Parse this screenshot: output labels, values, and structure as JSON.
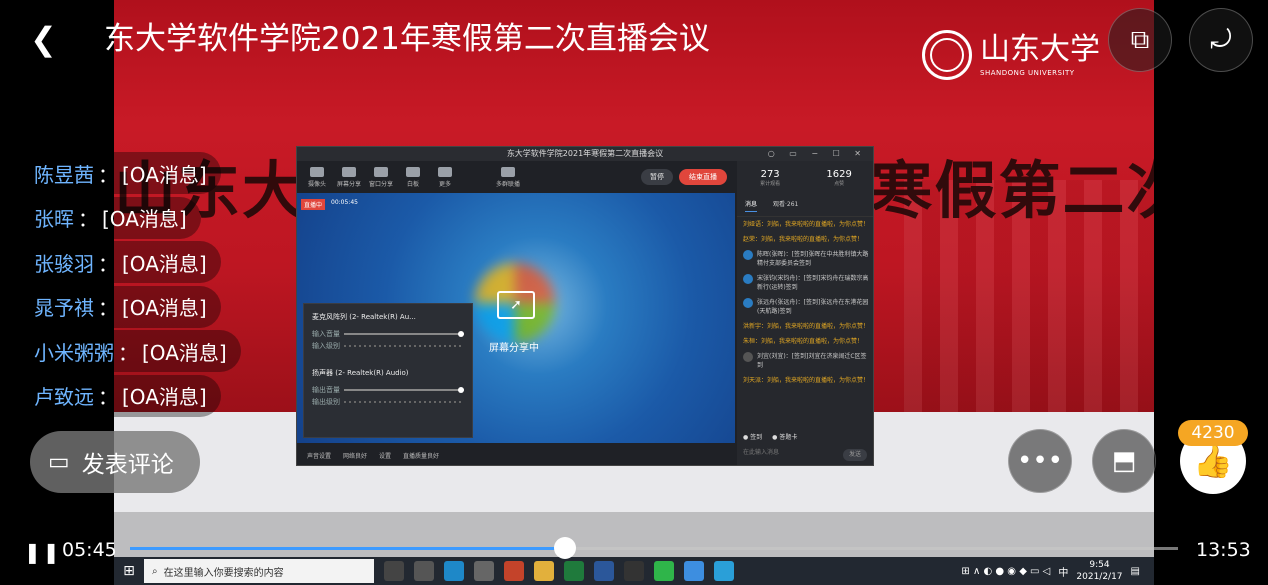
{
  "header": {
    "back_icon": "back-arrow-icon",
    "title": "东大学软件学院2021年寒假第二次直播会议",
    "pip_icon": "picture-in-picture-icon",
    "rotate_icon": "rotate-screen-icon"
  },
  "banner": {
    "title": "山东大学软件学院2021年寒假第二次直",
    "logo_cn": "山东大学",
    "logo_en": "SHANDONG UNIVERSITY"
  },
  "comments": [
    {
      "name": "陈昱茜",
      "sep": "：",
      "text": "[OA消息]"
    },
    {
      "name": "张晖",
      "sep": "：",
      "text": "[OA消息]"
    },
    {
      "name": "张骏羽",
      "sep": "：",
      "text": "[OA消息]"
    },
    {
      "name": "晁予祺",
      "sep": "：",
      "text": "[OA消息]"
    },
    {
      "name": "小米粥粥",
      "sep": "：",
      "text": "[OA消息]"
    },
    {
      "name": "卢致远",
      "sep": "：",
      "text": "[OA消息]"
    }
  ],
  "comment_button": {
    "label": "发表评论",
    "icon": "comment-icon"
  },
  "actions": {
    "more_icon": "more-dots-icon",
    "cast_icon": "cast-screen-icon",
    "like_count": "4230",
    "like_icon": "thumbs-up-icon"
  },
  "player": {
    "current_time": "05:45",
    "total_time": "13:53",
    "progress": 0.415
  },
  "shared_window": {
    "title": "东大学软件学院2021年寒假第二次直播会议",
    "tools": [
      "摄像头",
      "屏幕分享",
      "窗口分享",
      "白板",
      "更多",
      "多群联播"
    ],
    "pause_label": "暂停",
    "end_label": "结束直播",
    "live_tag": "直播中",
    "live_time": "00:05:45",
    "share_label": "屏幕分享中",
    "mic_device": "麦克风阵列 (2- Realtek(R) Au...",
    "speaker_device": "扬声器 (2- Realtek(R) Audio)",
    "input_volume": "输入音量",
    "input_level": "输入级别",
    "output_volume": "输出音量",
    "output_level": "输出级别",
    "bottom": [
      "声音设置",
      "网络良好",
      "设置",
      "直播质量良好"
    ],
    "stats": [
      {
        "num": "273",
        "label": "累计观看"
      },
      {
        "num": "1629",
        "label": "点赞"
      }
    ],
    "chat_tabs": [
      "消息",
      "观看·261"
    ],
    "chat": [
      {
        "t": "y",
        "text": "刘娅语：刘船，我来啦啦的直播啦，为你点赞！"
      },
      {
        "t": "y",
        "text": "赵荣：刘船，我来啦啦的直播啦，为你点赞！"
      },
      {
        "t": "w",
        "text": "陈晖(张晖)：[签到]张晖在中共胜利镇大路精付支部委员会签到"
      },
      {
        "t": "w",
        "text": "宋张钧(宋钧舟)：[签到]宋钧舟在瑞数宗高新行(运转)签到"
      },
      {
        "t": "w",
        "text": "张远舟(张远舟)：[签到]张远舟在东港花园(天航路)签到"
      },
      {
        "t": "y",
        "text": "洪新宇：刘船，我来啦啦的直播啦，为你点赞！"
      },
      {
        "t": "y",
        "text": "朱桓：刘船，我来啦啦的直播啦，为你点赞！"
      },
      {
        "t": "w",
        "text": "刘宜(刘宜)：[签到]刘宜在济泉阔迁C区签到"
      },
      {
        "t": "y",
        "text": "刘天派：刘船，我来啦啦的直播啦，为你点赞！"
      }
    ],
    "toggles": [
      "签到",
      "答题卡"
    ],
    "chat_input": "在此输入消息",
    "send_label": "发送"
  },
  "taskbar": {
    "search_placeholder": "在这里输入你要搜索的内容",
    "clock_time": "9:54",
    "clock_date": "2021/2/17",
    "ime": "中"
  }
}
